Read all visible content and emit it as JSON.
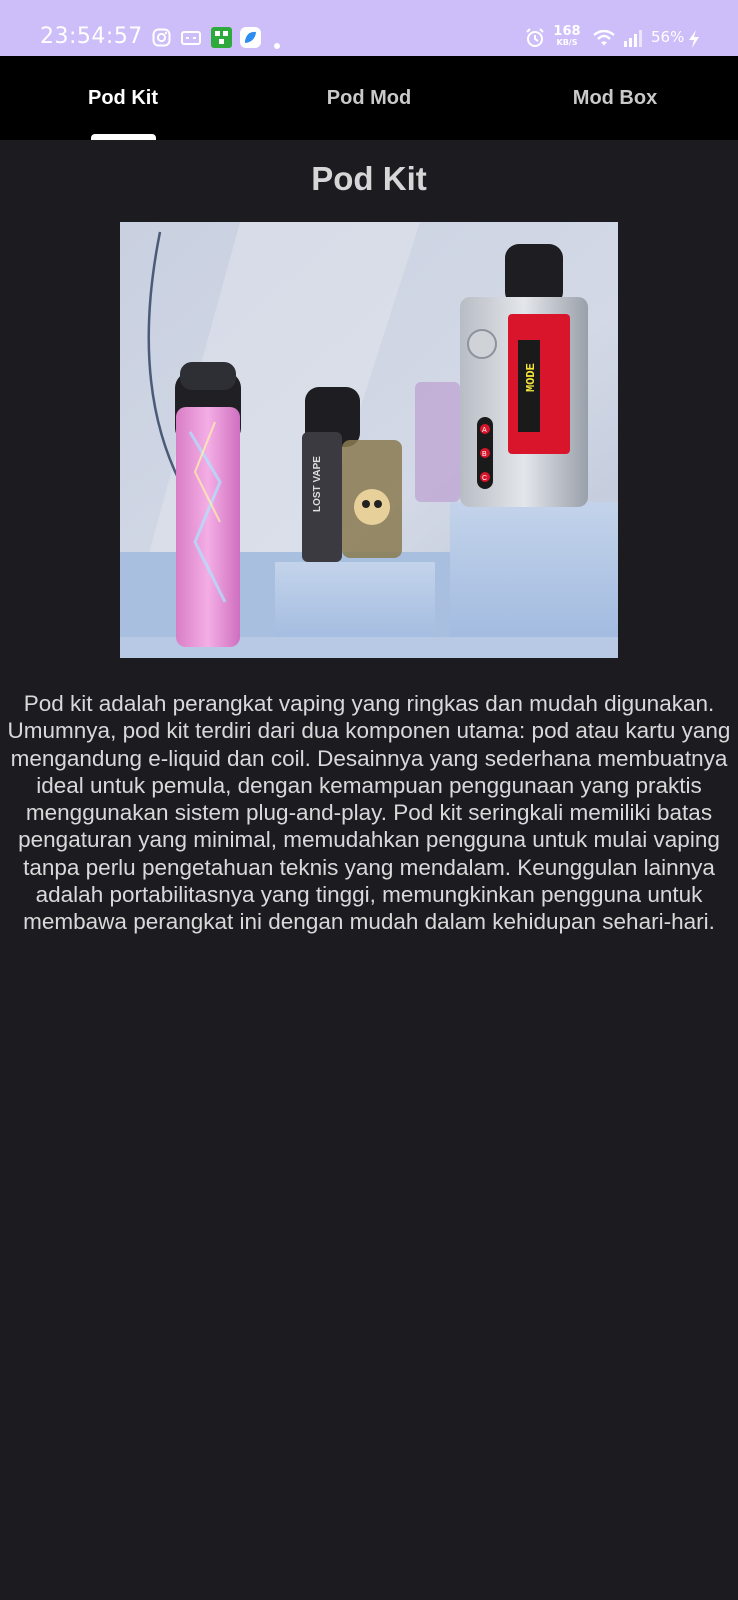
{
  "status_bar": {
    "time": "23:54:57",
    "network_speed_value": "168",
    "network_speed_unit": "KB/S",
    "battery": "56%",
    "icons": [
      "instagram-icon",
      "message-icon",
      "app-icon",
      "app-icon",
      "notification-dot-icon",
      "alarm-icon",
      "wifi-icon",
      "signal-icon",
      "charging-icon"
    ]
  },
  "tabs": [
    {
      "label": "Pod Kit",
      "active": true
    },
    {
      "label": "Pod Mod",
      "active": false
    },
    {
      "label": "Mod Box",
      "active": false
    }
  ],
  "main": {
    "title": "Pod Kit",
    "image": {
      "brand_text": "LOST VAPE",
      "screen_text": "MODE",
      "button_labels": [
        "A",
        "B",
        "C"
      ]
    },
    "description": "Pod kit adalah perangkat vaping yang ringkas dan mudah digunakan. Umumnya, pod kit terdiri dari dua komponen utama: pod atau kartu yang mengandung e-liquid dan coil. Desainnya yang sederhana membuatnya ideal untuk pemula, dengan kemampuan penggunaan yang praktis menggunakan sistem plug-and-play. Pod kit seringkali memiliki batas pengaturan yang minimal, memudahkan pengguna untuk mulai vaping tanpa perlu pengetahuan teknis yang mendalam. Keunggulan lainnya adalah portabilitasnya yang tinggi, memungkinkan pengguna untuk membawa perangkat ini dengan mudah dalam kehidupan sehari-hari."
  },
  "colors": {
    "status_bar": "#cdbdf8",
    "tab_bar": "#000000",
    "background": "#1c1b20",
    "text": "#d9d9d9"
  }
}
